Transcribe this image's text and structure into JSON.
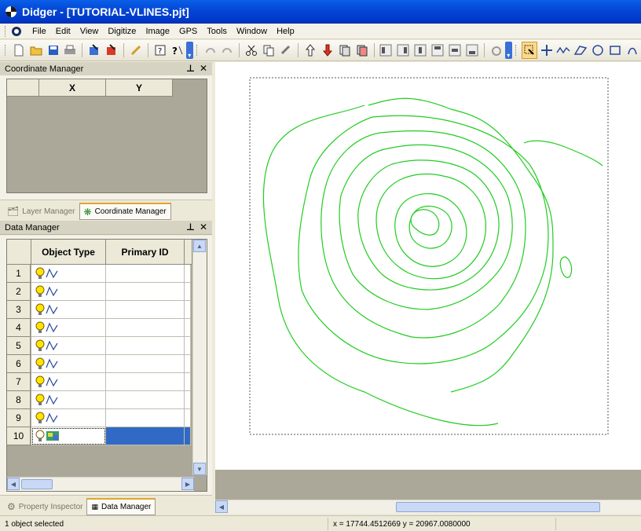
{
  "window": {
    "title": "Didger - [TUTORIAL-VLINES.pjt]"
  },
  "menu": [
    {
      "label": "File",
      "key": "F"
    },
    {
      "label": "Edit",
      "key": "E"
    },
    {
      "label": "View",
      "key": "V"
    },
    {
      "label": "Digitize",
      "key": "g"
    },
    {
      "label": "Image",
      "key": "I"
    },
    {
      "label": "GPS",
      "key": "G"
    },
    {
      "label": "Tools",
      "key": "T"
    },
    {
      "label": "Window",
      "key": "W"
    },
    {
      "label": "Help",
      "key": "H"
    }
  ],
  "coordinate_manager": {
    "title": "Coordinate Manager",
    "columns": [
      "X",
      "Y"
    ]
  },
  "tabs_top": [
    {
      "label": "Layer Manager",
      "icon": "layer-icon",
      "selected": false
    },
    {
      "label": "Coordinate Manager",
      "icon": "coordinate-icon",
      "selected": true
    }
  ],
  "data_manager": {
    "title": "Data Manager",
    "columns": [
      "Object Type",
      "Primary ID"
    ],
    "rows": [
      "1",
      "2",
      "3",
      "4",
      "5",
      "6",
      "7",
      "8",
      "9",
      "10"
    ],
    "selected_row": "10"
  },
  "tabs_bottom": [
    {
      "label": "Property Inspector",
      "icon": "property-icon",
      "selected": false
    },
    {
      "label": "Data Manager",
      "icon": "data-icon",
      "selected": true
    }
  ],
  "status": {
    "selection": "1 object selected",
    "coords": "x = 17744.4512669  y = 20967.0080000"
  },
  "colors": {
    "contour": "#22cc22",
    "accent": "#316ac5"
  }
}
